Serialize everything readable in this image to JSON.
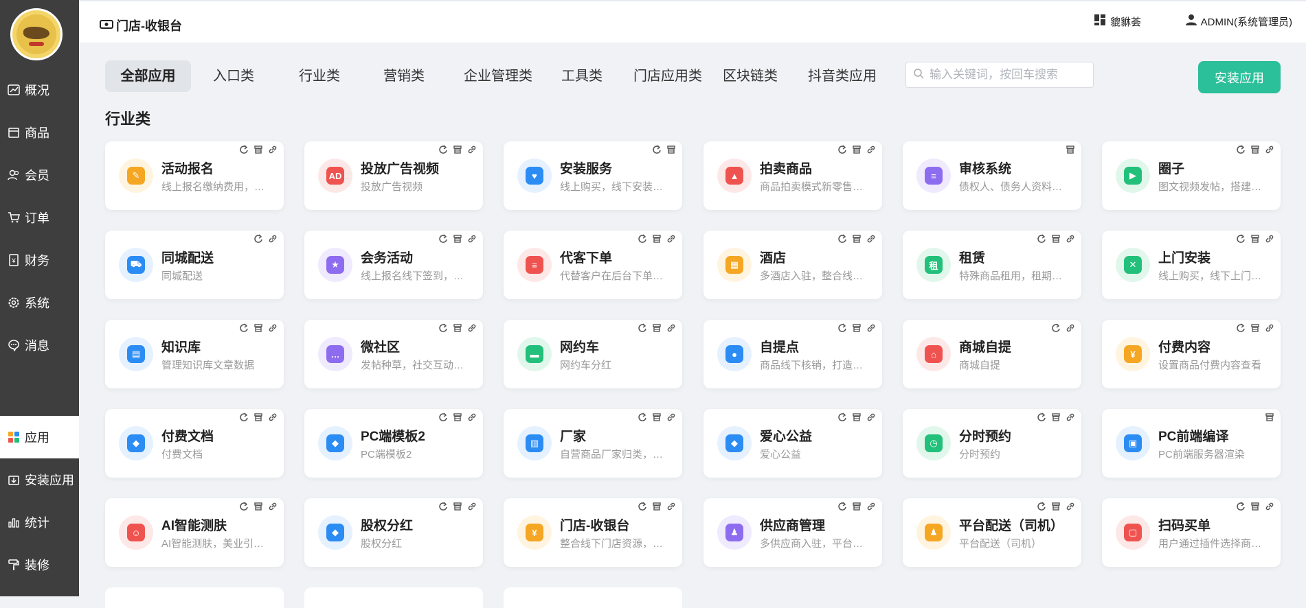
{
  "sidebar": {
    "items": [
      {
        "label": "概况",
        "icon": "chart-line-icon"
      },
      {
        "label": "商品",
        "icon": "shop-icon"
      },
      {
        "label": "会员",
        "icon": "users-icon"
      },
      {
        "label": "订单",
        "icon": "cart-icon"
      },
      {
        "label": "财务",
        "icon": "finance-icon"
      },
      {
        "label": "系统",
        "icon": "gear-icon"
      },
      {
        "label": "消息",
        "icon": "message-icon"
      },
      {
        "label": "应用",
        "icon": "apps-icon",
        "active": true
      },
      {
        "label": "安装应用",
        "icon": "download-icon"
      },
      {
        "label": "统计",
        "icon": "bar-chart-icon"
      },
      {
        "label": "装修",
        "icon": "brush-icon"
      }
    ]
  },
  "header": {
    "breadcrumb": "门店-收银台",
    "shop_label": "貔貅荟",
    "user_label": "ADMIN(系统管理员)"
  },
  "tabs": [
    "全部应用",
    "入口类",
    "行业类",
    "营销类",
    "企业管理类",
    "工具类",
    "门店应用类",
    "区块链类",
    "抖音类应用"
  ],
  "search": {
    "placeholder": "输入关键词，按回车搜索"
  },
  "install_button": "安装应用",
  "section_title": "行业类",
  "apps": [
    {
      "title": "活动报名",
      "desc": "线上报名缴纳费用，…",
      "color": "#f5a623",
      "bg": "#fff4e0",
      "glyph": "✎",
      "acts": [
        "refresh",
        "store",
        "link"
      ]
    },
    {
      "title": "投放广告视频",
      "desc": "投放广告视频",
      "color": "#ef5350",
      "bg": "#fde8e8",
      "glyph": "AD",
      "acts": [
        "refresh",
        "store",
        "link"
      ]
    },
    {
      "title": "安装服务",
      "desc": "线上购买，线下安装…",
      "color": "#2b8cf3",
      "bg": "#e5f1fe",
      "glyph": "♥",
      "acts": [
        "refresh",
        "store"
      ]
    },
    {
      "title": "拍卖商品",
      "desc": "商品拍卖模式新零售…",
      "color": "#ef5350",
      "bg": "#fde8e8",
      "glyph": "▲",
      "acts": [
        "refresh",
        "store",
        "link"
      ]
    },
    {
      "title": "审核系统",
      "desc": "债权人、债务人资料…",
      "color": "#8e6cf0",
      "bg": "#efeafe",
      "glyph": "≡",
      "acts": [
        "store"
      ]
    },
    {
      "title": "圈子",
      "desc": "图文视频发帖，搭建…",
      "color": "#22c07a",
      "bg": "#e2f7ec",
      "glyph": "▶",
      "acts": [
        "refresh",
        "store",
        "link"
      ]
    },
    {
      "title": "同城配送",
      "desc": "同城配送",
      "color": "#2b8cf3",
      "bg": "#e5f1fe",
      "glyph": "⛟",
      "acts": [
        "refresh",
        "link"
      ]
    },
    {
      "title": "会务活动",
      "desc": "线上报名线下签到，…",
      "color": "#8e6cf0",
      "bg": "#efeafe",
      "glyph": "★",
      "acts": [
        "refresh",
        "store",
        "link"
      ]
    },
    {
      "title": "代客下单",
      "desc": "代替客户在后台下单…",
      "color": "#ef5350",
      "bg": "#fde8e8",
      "glyph": "≡",
      "acts": [
        "refresh",
        "store",
        "link"
      ]
    },
    {
      "title": "酒店",
      "desc": "多酒店入驻，整合线…",
      "color": "#f5a623",
      "bg": "#fff4e0",
      "glyph": "▦",
      "acts": [
        "refresh",
        "store",
        "link"
      ]
    },
    {
      "title": "租赁",
      "desc": "特殊商品租用，租期…",
      "color": "#22c07a",
      "bg": "#e2f7ec",
      "glyph": "租",
      "acts": [
        "refresh",
        "store",
        "link"
      ]
    },
    {
      "title": "上门安装",
      "desc": "线上购买，线下上门…",
      "color": "#22c07a",
      "bg": "#e2f7ec",
      "glyph": "✕",
      "acts": [
        "refresh",
        "store",
        "link"
      ]
    },
    {
      "title": "知识库",
      "desc": "管理知识库文章数据",
      "color": "#2b8cf3",
      "bg": "#e5f1fe",
      "glyph": "▤",
      "acts": [
        "refresh",
        "store",
        "link"
      ]
    },
    {
      "title": "微社区",
      "desc": "发帖种草，社交互动…",
      "color": "#8e6cf0",
      "bg": "#efeafe",
      "glyph": "…",
      "acts": [
        "refresh",
        "store",
        "link"
      ]
    },
    {
      "title": "网约车",
      "desc": "网约车分红",
      "color": "#22c07a",
      "bg": "#e2f7ec",
      "glyph": "▬",
      "acts": [
        "refresh",
        "store",
        "link"
      ]
    },
    {
      "title": "自提点",
      "desc": "商品线下核销，打造…",
      "color": "#2b8cf3",
      "bg": "#e5f1fe",
      "glyph": "●",
      "acts": [
        "refresh",
        "store",
        "link"
      ]
    },
    {
      "title": "商城自提",
      "desc": "商城自提",
      "color": "#ef5350",
      "bg": "#fde8e8",
      "glyph": "⌂",
      "acts": [
        "refresh",
        "link"
      ]
    },
    {
      "title": "付费内容",
      "desc": "设置商品付费内容查看",
      "color": "#f5a623",
      "bg": "#fff4e0",
      "glyph": "¥",
      "acts": [
        "refresh",
        "store",
        "link"
      ]
    },
    {
      "title": "付费文档",
      "desc": "付费文档",
      "color": "#2b8cf3",
      "bg": "#e5f1fe",
      "glyph": "◆",
      "acts": [
        "refresh",
        "store",
        "link"
      ]
    },
    {
      "title": "PC端模板2",
      "desc": "PC端模板2",
      "color": "#2b8cf3",
      "bg": "#e5f1fe",
      "glyph": "◆",
      "acts": [
        "refresh",
        "store",
        "link"
      ]
    },
    {
      "title": "厂家",
      "desc": "自营商品厂家归类，…",
      "color": "#2b8cf3",
      "bg": "#e5f1fe",
      "glyph": "▥",
      "acts": [
        "refresh",
        "store",
        "link"
      ]
    },
    {
      "title": "爱心公益",
      "desc": "爱心公益",
      "color": "#2b8cf3",
      "bg": "#e5f1fe",
      "glyph": "◆",
      "acts": [
        "refresh",
        "store",
        "link"
      ]
    },
    {
      "title": "分时预约",
      "desc": "分时预约",
      "color": "#22c07a",
      "bg": "#e2f7ec",
      "glyph": "◷",
      "acts": [
        "refresh",
        "store",
        "link"
      ]
    },
    {
      "title": "PC前端编译",
      "desc": "PC前端服务器渲染",
      "color": "#2b8cf3",
      "bg": "#e5f1fe",
      "glyph": "▣",
      "acts": [
        "store"
      ]
    },
    {
      "title": "AI智能测肤",
      "desc": "AI智能测肤，美业引…",
      "color": "#ef5350",
      "bg": "#fde8e8",
      "glyph": "☺",
      "acts": [
        "refresh",
        "store",
        "link"
      ]
    },
    {
      "title": "股权分红",
      "desc": "股权分红",
      "color": "#2b8cf3",
      "bg": "#e5f1fe",
      "glyph": "◆",
      "acts": [
        "refresh",
        "store",
        "link"
      ]
    },
    {
      "title": "门店-收银台",
      "desc": "整合线下门店资源，…",
      "color": "#f5a623",
      "bg": "#fff4e0",
      "glyph": "¥",
      "acts": [
        "refresh",
        "store",
        "link"
      ]
    },
    {
      "title": "供应商管理",
      "desc": "多供应商入驻，平台…",
      "color": "#8e6cf0",
      "bg": "#efeafe",
      "glyph": "♟",
      "acts": [
        "refresh",
        "store",
        "link"
      ]
    },
    {
      "title": "平台配送（司机）",
      "desc": "平台配送（司机）",
      "color": "#f5a623",
      "bg": "#fff4e0",
      "glyph": "♟",
      "acts": [
        "refresh",
        "store",
        "link"
      ]
    },
    {
      "title": "扫码买单",
      "desc": "用户通过插件选择商…",
      "color": "#ef5350",
      "bg": "#fde8e8",
      "glyph": "▢",
      "acts": [
        "refresh",
        "store",
        "link"
      ]
    }
  ]
}
